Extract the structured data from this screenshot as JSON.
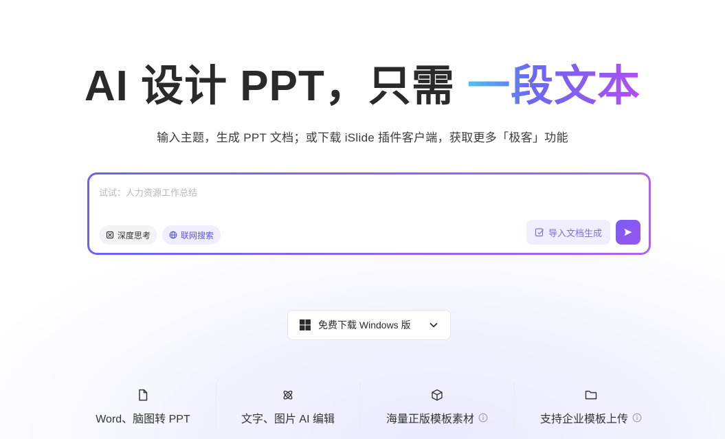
{
  "hero": {
    "title_main": "AI 设计 PPT，只需 ",
    "title_highlight": "一段文本",
    "subtitle": "输入主题，生成 PPT 文档；或下载 iSlide 插件客户端，获取更多「极客」功能"
  },
  "prompt": {
    "placeholder": "试试：人力资源工作总结",
    "value": "",
    "deep_think_label": "深度思考",
    "web_search_label": "联网搜索",
    "import_label": "导入文档生成"
  },
  "download": {
    "label": "免费下载 Windows 版"
  },
  "features": [
    {
      "label": "Word、脑图转 PPT",
      "icon": "file-icon"
    },
    {
      "label": "文字、图片 AI 编辑",
      "icon": "atom-icon"
    },
    {
      "label": "海量正版模板素材",
      "icon": "cube-icon",
      "info": true
    },
    {
      "label": "支持企业模板上传",
      "icon": "folder-icon",
      "info": true
    }
  ],
  "colors": {
    "accent": "#7a5cf5",
    "gradient_start": "#4cc3f5",
    "gradient_end": "#b14ff0"
  }
}
